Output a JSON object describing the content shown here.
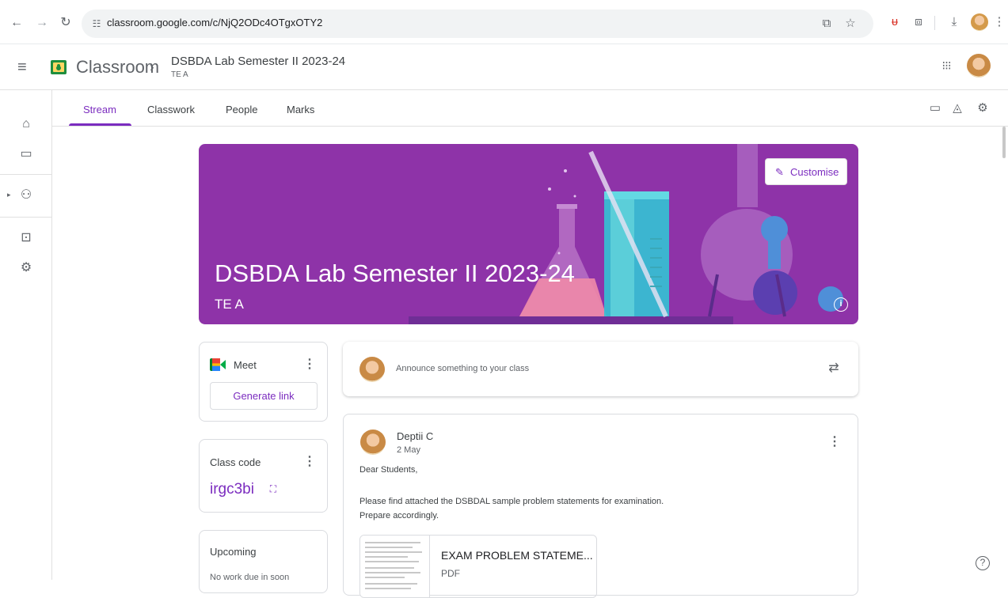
{
  "browser": {
    "url": "classroom.google.com/c/NjQ2ODc4OTgxOTY2",
    "icons": [
      "back-icon",
      "forward-icon",
      "reload-icon",
      "site-info-icon",
      "install-app-icon",
      "bookmark-star-icon",
      "extension-icon",
      "puzzle-extensions-icon",
      "download-icon",
      "profile-avatar-icon",
      "browser-menu-icon"
    ]
  },
  "app": {
    "name": "Classroom",
    "breadcrumb_course": "DSBDA Lab Semester II 2023-24",
    "breadcrumb_section": "TE A"
  },
  "tabs": [
    {
      "label": "Stream",
      "active": true
    },
    {
      "label": "Classwork",
      "active": false
    },
    {
      "label": "People",
      "active": false
    },
    {
      "label": "Marks",
      "active": false
    }
  ],
  "banner": {
    "title": "DSBDA Lab Semester II 2023-24",
    "section": "TE A",
    "customise_label": "Customise",
    "color": "#8e33a8"
  },
  "meet": {
    "label": "Meet",
    "generate_link": "Generate link"
  },
  "class_code": {
    "label": "Class code",
    "value": "irgc3bi"
  },
  "upcoming": {
    "label": "Upcoming",
    "status": "No work due in soon"
  },
  "announce": {
    "placeholder": "Announce something to your class"
  },
  "post": {
    "author": "Deptii C",
    "date": "2 May",
    "greeting": "Dear Students,",
    "line1": "Please find attached the DSBDAL sample problem statements for examination.",
    "line2": "Prepare accordingly.",
    "attachment_title": "EXAM PROBLEM STATEME...",
    "attachment_type": "PDF"
  },
  "colors": {
    "accent": "#7b2cbf",
    "banner": "#8e33a8"
  }
}
